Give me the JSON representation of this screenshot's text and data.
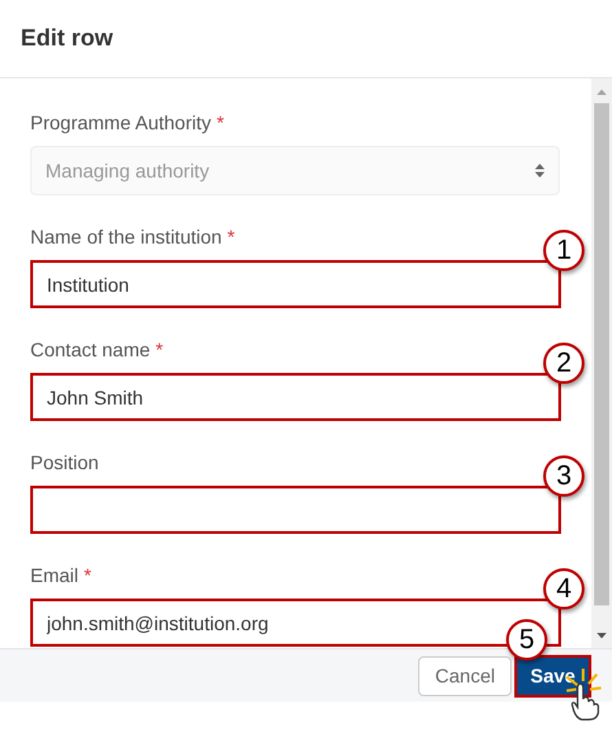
{
  "dialog": {
    "title": "Edit row"
  },
  "fields": [
    {
      "kind": "select",
      "label": "Programme Authority",
      "required_mark": "*",
      "value": "Managing authority",
      "disabled": true
    },
    {
      "kind": "input",
      "label": "Name of the institution",
      "required_mark": "*",
      "value": "Institution",
      "callout": "1"
    },
    {
      "kind": "input",
      "label": "Contact name",
      "required_mark": "*",
      "value": "John Smith",
      "callout": "2"
    },
    {
      "kind": "input",
      "label": "Position",
      "callout": "3"
    },
    {
      "kind": "input",
      "label": "Email",
      "required_mark": "*",
      "value": "john.smith@institution.org",
      "callout": "4"
    }
  ],
  "buttons": [
    {
      "kind": "secondary",
      "label": "Cancel"
    },
    {
      "kind": "primary",
      "label": "Save",
      "callout": "5"
    }
  ]
}
